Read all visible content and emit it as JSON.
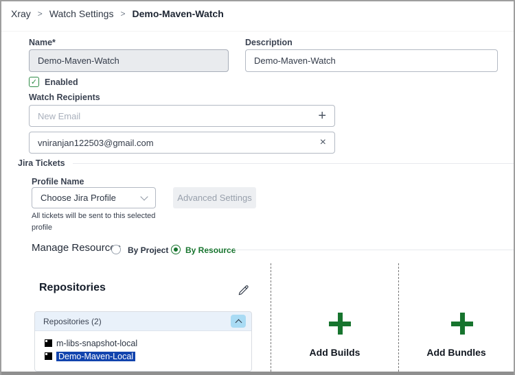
{
  "breadcrumb": {
    "separator": ">",
    "items": [
      {
        "label": "Xray"
      },
      {
        "label": "Watch Settings"
      },
      {
        "label": "Demo-Maven-Watch"
      }
    ]
  },
  "form": {
    "name": {
      "label": "Name*",
      "value": "Demo-Maven-Watch"
    },
    "description": {
      "label": "Description",
      "value": "Demo-Maven-Watch"
    },
    "enabled": {
      "label": "Enabled",
      "checked": true,
      "check_glyph": "✓"
    },
    "watch_recipients": {
      "label": "Watch Recipients",
      "placeholder": "New Email",
      "add_icon": "+",
      "remove_icon": "×",
      "recipients": [
        "vniranjan122503@gmail.com"
      ]
    }
  },
  "jira": {
    "section_label": "Jira Tickets",
    "profile_label": "Profile Name",
    "selected_profile": "Choose Jira Profile",
    "advanced_button_label": "Advanced Settings",
    "helper_text": "All tickets will be sent to this selected profile"
  },
  "manage_resources": {
    "label": "Manage Resources",
    "options": [
      {
        "label": "By Project",
        "selected": false
      },
      {
        "label": "By Resource",
        "selected": true
      }
    ]
  },
  "repositories": {
    "title": "Repositories",
    "group_header": "Repositories (2)",
    "items": [
      {
        "name": "m-libs-snapshot-local",
        "selected": false
      },
      {
        "name": "Demo-Maven-Local",
        "selected": true
      }
    ]
  },
  "builds": {
    "label": "Add Builds"
  },
  "bundles": {
    "label": "Add Bundles"
  },
  "colors": {
    "accent_green": "#17742e",
    "selection_blue": "#1244ae",
    "panel_header_blue": "#e9f1fa",
    "disabled_input_bg": "#e9ebee",
    "collapse_button_blue": "#a9dbf4"
  }
}
